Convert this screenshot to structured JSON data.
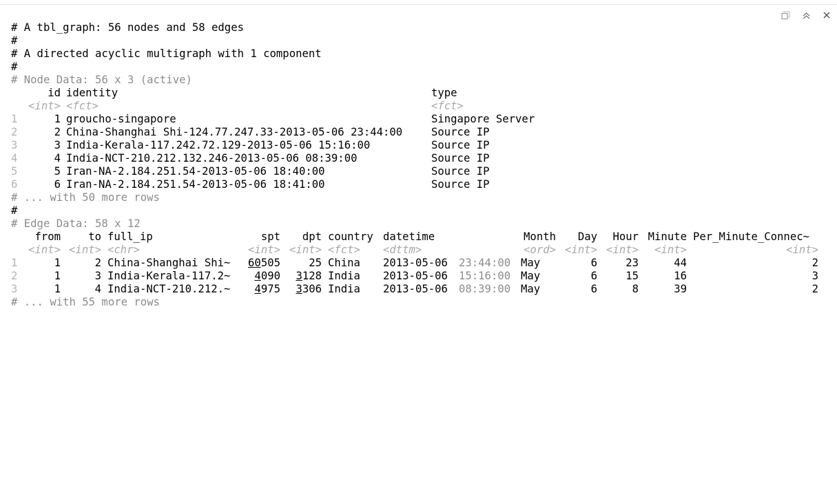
{
  "toolbar": {
    "icons": [
      "restore-icon",
      "collapse-icon",
      "close-icon"
    ]
  },
  "summary": {
    "header": "# A tbl_graph: 56 nodes and 58 edges",
    "blank1": "#",
    "graph_desc": "# A directed acyclic multigraph with 1 component",
    "blank2": "#"
  },
  "nodes": {
    "title": "# Node Data: 56 x 3 (active)",
    "columns": [
      {
        "name": "id",
        "type": "<int>"
      },
      {
        "name": "identity",
        "type": "<fct>"
      },
      {
        "name": "type",
        "type": "<fct>"
      }
    ],
    "rows": [
      {
        "rn": "1",
        "id": "1",
        "identity": "groucho-singapore",
        "type": "Singapore Server"
      },
      {
        "rn": "2",
        "id": "2",
        "identity": "China-Shanghai Shi-124.77.247.33-2013-05-06 23:44:00",
        "type": "Source IP"
      },
      {
        "rn": "3",
        "id": "3",
        "identity": "India-Kerala-117.242.72.129-2013-05-06 15:16:00",
        "type": "Source IP"
      },
      {
        "rn": "4",
        "id": "4",
        "identity": "India-NCT-210.212.132.246-2013-05-06 08:39:00",
        "type": "Source IP"
      },
      {
        "rn": "5",
        "id": "5",
        "identity": "Iran-NA-2.184.251.54-2013-05-06 18:40:00",
        "type": "Source IP"
      },
      {
        "rn": "6",
        "id": "6",
        "identity": "Iran-NA-2.184.251.54-2013-05-06 18:41:00",
        "type": "Source IP"
      }
    ],
    "more": "# ... with 50 more rows"
  },
  "blank3": "#",
  "edges": {
    "title": "# Edge Data: 58 x 12",
    "columns": [
      {
        "name": "from",
        "type": "<int>"
      },
      {
        "name": "to",
        "type": "<int>"
      },
      {
        "name": "full_ip",
        "type": "<chr>"
      },
      {
        "name": "spt",
        "type": "<int>"
      },
      {
        "name": "dpt",
        "type": "<int>"
      },
      {
        "name": "country",
        "type": "<fct>"
      },
      {
        "name": "datetime",
        "type": "<dttm>"
      },
      {
        "name": "Month",
        "type": "<ord>"
      },
      {
        "name": "Day",
        "type": "<int>"
      },
      {
        "name": "Hour",
        "type": "<int>"
      },
      {
        "name": "Minute",
        "type": "<int>"
      },
      {
        "name": "Per_Minute_Connec~",
        "type": "<int>"
      }
    ],
    "rows": [
      {
        "rn": "1",
        "from": "1",
        "to": "2",
        "full_ip": "China-Shanghai Shi~",
        "spt_a": "60",
        "spt_b": "505",
        "dpt_a": "",
        "dpt_b": "25",
        "country": "China",
        "date": "2013-05-06",
        "time": "23:44:00",
        "month": "May",
        "day": "6",
        "hour": "23",
        "minute": "44",
        "pmc": "2"
      },
      {
        "rn": "2",
        "from": "1",
        "to": "3",
        "full_ip": "India-Kerala-117.2~",
        "spt_a": "4",
        "spt_b": "090",
        "dpt_a": "3",
        "dpt_b": "128",
        "country": "India",
        "date": "2013-05-06",
        "time": "15:16:00",
        "month": "May",
        "day": "6",
        "hour": "15",
        "minute": "16",
        "pmc": "3"
      },
      {
        "rn": "3",
        "from": "1",
        "to": "4",
        "full_ip": "India-NCT-210.212.~",
        "spt_a": "4",
        "spt_b": "975",
        "dpt_a": "3",
        "dpt_b": "306",
        "country": "India",
        "date": "2013-05-06",
        "time": "08:39:00",
        "month": "May",
        "day": "6",
        "hour": "8",
        "minute": "39",
        "pmc": "2"
      }
    ],
    "more": "# ... with 55 more rows"
  }
}
